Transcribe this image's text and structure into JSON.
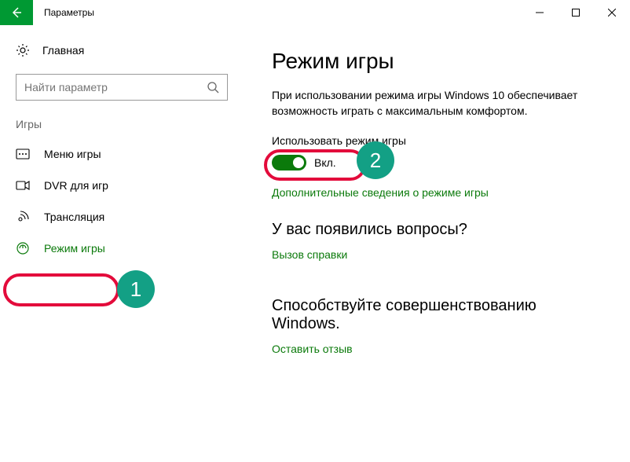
{
  "window": {
    "title": "Параметры"
  },
  "sidebar": {
    "home": "Главная",
    "search_placeholder": "Найти параметр",
    "section": "Игры",
    "items": [
      {
        "label": "Меню игры"
      },
      {
        "label": "DVR для игр"
      },
      {
        "label": "Трансляция"
      },
      {
        "label": "Режим игры"
      }
    ]
  },
  "content": {
    "title": "Режим игры",
    "description": "При использовании режима игры Windows 10 обеспечивает возможность играть с максимальным комфортом.",
    "toggle_label": "Использовать режим игры",
    "toggle_state": "Вкл.",
    "more_info_link": "Дополнительные сведения о режиме игры",
    "help_heading": "У вас появились вопросы?",
    "help_link": "Вызов справки",
    "feedback_heading": "Способствуйте совершенствованию Windows.",
    "feedback_link": "Оставить отзыв"
  },
  "annotations": {
    "badge1": "1",
    "badge2": "2"
  }
}
